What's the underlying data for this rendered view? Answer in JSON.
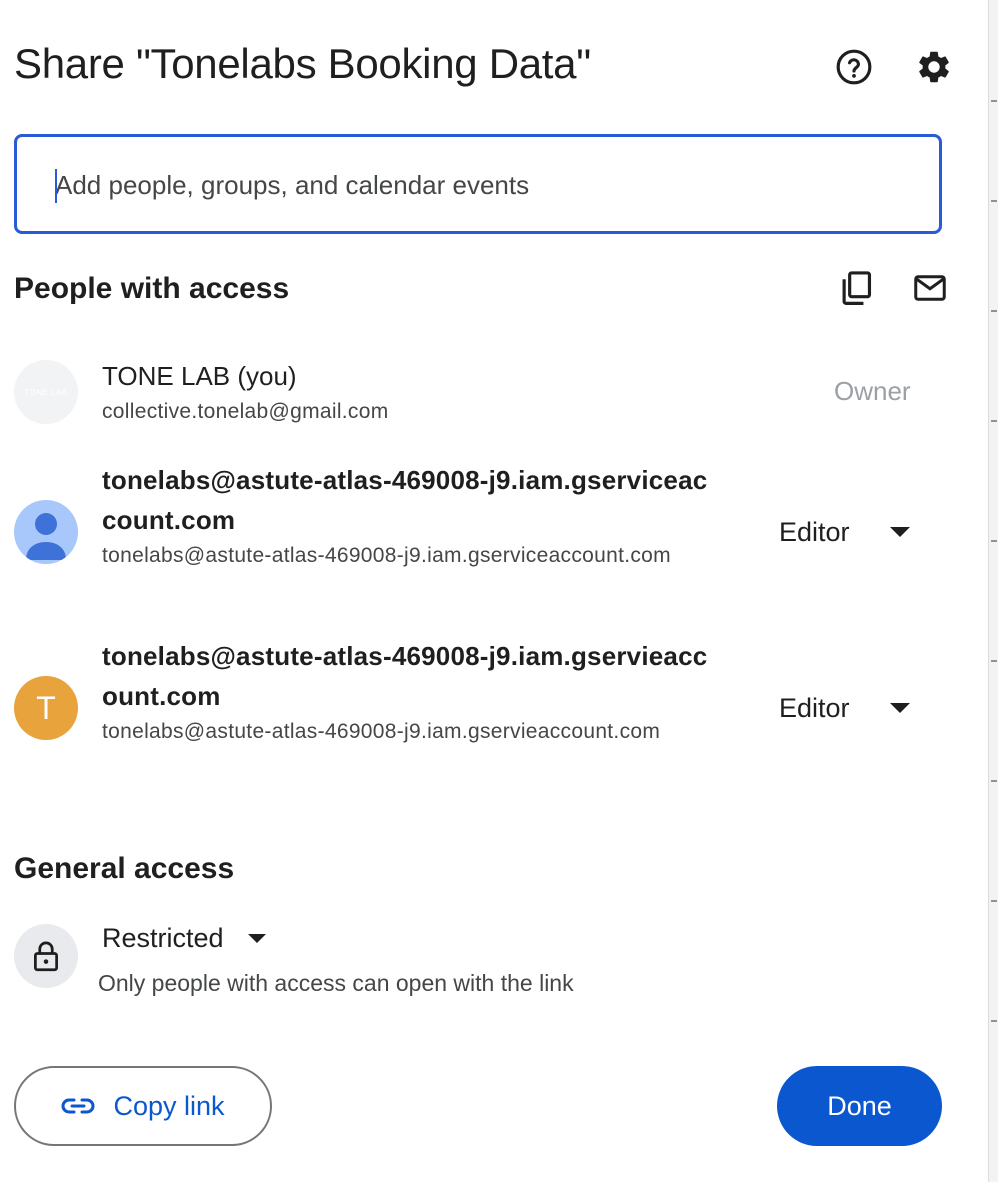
{
  "dialog": {
    "title": "Share \"Tonelabs Booking Data\"",
    "help_icon": "help-circle-icon",
    "settings_icon": "gear-icon"
  },
  "search": {
    "placeholder": "Add people, groups, and calendar events",
    "value": ""
  },
  "people_section": {
    "title": "People with access",
    "copy_icon": "copy-icon",
    "email_icon": "email-icon",
    "people": [
      {
        "name": "TONE LAB (you)",
        "email": "collective.tonelab@gmail.com",
        "role": "Owner",
        "avatar_text": "TONE LAB"
      },
      {
        "name": "tonelabs@astute-atlas-469008-j9.iam.gserviceaccount.com",
        "email": "tonelabs@astute-atlas-469008-j9.iam.gserviceaccount.com",
        "role": "Editor",
        "avatar_icon": "person-icon"
      },
      {
        "name": "tonelabs@astute-atlas-469008-j9.iam.gservieaccount.com",
        "email": "tonelabs@astute-atlas-469008-j9.iam.gservieaccount.com",
        "role": "Editor",
        "avatar_text": "T"
      }
    ]
  },
  "general_access": {
    "title": "General access",
    "lock_icon": "lock-icon",
    "level": "Restricted",
    "description": "Only people with access can open with the link"
  },
  "footer": {
    "copy_link_label": "Copy link",
    "link_icon": "link-icon",
    "done_label": "Done"
  },
  "colors": {
    "accent": "#0b57d0",
    "focus_border": "#2a5bd7",
    "avatar_orange": "#e8a33c",
    "avatar_blue": "#a8c7fa"
  }
}
